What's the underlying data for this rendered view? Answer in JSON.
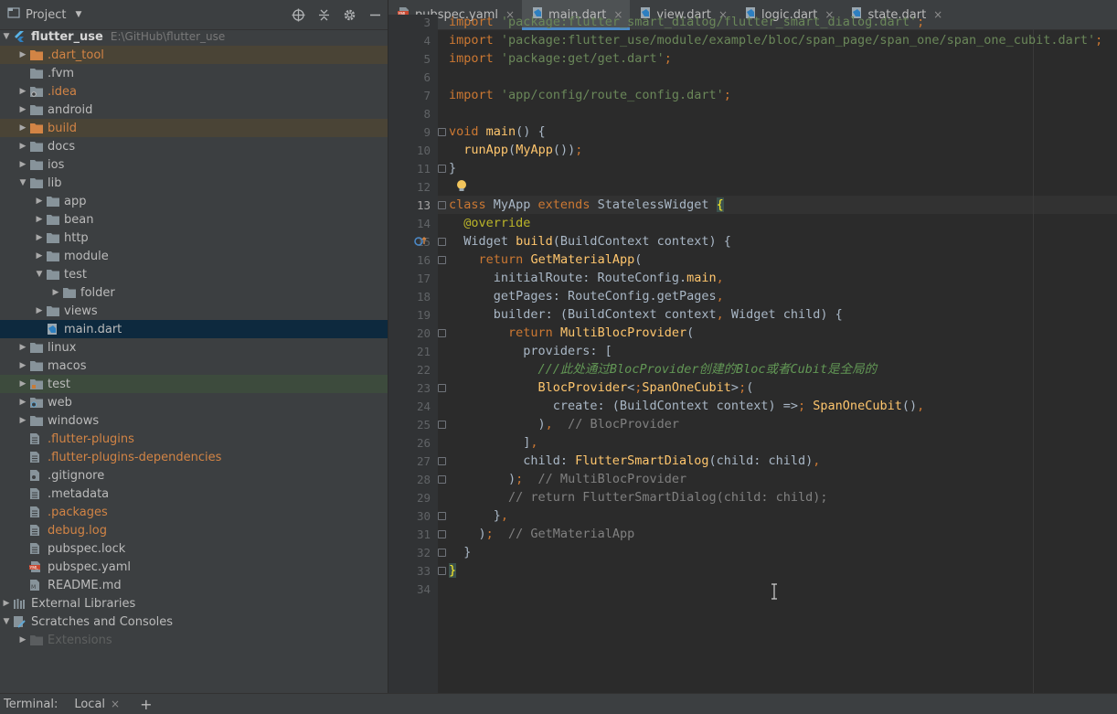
{
  "project": {
    "title": "Project",
    "root_name": "flutter_use",
    "root_path": "E:\\GitHub\\flutter_use",
    "items": [
      {
        "label": ".dart_tool",
        "style": "orange"
      },
      {
        "label": ".fvm",
        "style": ""
      },
      {
        "label": ".idea",
        "style": "orange"
      },
      {
        "label": "android",
        "style": ""
      },
      {
        "label": "build",
        "style": "orange"
      },
      {
        "label": "docs",
        "style": ""
      },
      {
        "label": "ios",
        "style": ""
      },
      {
        "label": "lib",
        "style": ""
      },
      {
        "label": "app",
        "style": ""
      },
      {
        "label": "bean",
        "style": ""
      },
      {
        "label": "http",
        "style": ""
      },
      {
        "label": "module",
        "style": ""
      },
      {
        "label": "test",
        "style": ""
      },
      {
        "label": "folder",
        "style": ""
      },
      {
        "label": "views",
        "style": ""
      },
      {
        "label": "main.dart",
        "style": ""
      },
      {
        "label": "linux",
        "style": ""
      },
      {
        "label": "macos",
        "style": ""
      },
      {
        "label": "test",
        "style": ""
      },
      {
        "label": "web",
        "style": ""
      },
      {
        "label": "windows",
        "style": ""
      },
      {
        "label": ".flutter-plugins",
        "style": "orange"
      },
      {
        "label": ".flutter-plugins-dependencies",
        "style": "orange"
      },
      {
        "label": ".gitignore",
        "style": ""
      },
      {
        "label": ".metadata",
        "style": ""
      },
      {
        "label": ".packages",
        "style": "orange"
      },
      {
        "label": "debug.log",
        "style": "orange"
      },
      {
        "label": "pubspec.lock",
        "style": ""
      },
      {
        "label": "pubspec.yaml",
        "style": ""
      },
      {
        "label": "README.md",
        "style": ""
      },
      {
        "label": "External Libraries",
        "style": ""
      },
      {
        "label": "Scratches and Consoles",
        "style": ""
      },
      {
        "label": "Extensions",
        "style": "dim"
      }
    ]
  },
  "tabs": [
    {
      "label": "pubspec.yaml",
      "active": false
    },
    {
      "label": "main.dart",
      "active": true
    },
    {
      "label": "view.dart",
      "active": false
    },
    {
      "label": "logic.dart",
      "active": false
    },
    {
      "label": "state.dart",
      "active": false
    }
  ],
  "code": {
    "line_numbers": [
      "3",
      "4",
      "5",
      "6",
      "7",
      "8",
      "9",
      "10",
      "11",
      "12",
      "13",
      "14",
      "15",
      "16",
      "17",
      "18",
      "19",
      "20",
      "21",
      "22",
      "23",
      "24",
      "25",
      "26",
      "27",
      "28",
      "29",
      "30",
      "31",
      "32",
      "33",
      "34"
    ],
    "current_line": "13",
    "lines": [
      "import 'package:flutter_smart_dialog/flutter_smart_dialog.dart';",
      "import 'package:flutter_use/module/example/bloc/span_page/span_one/span_one_cubit.dart';",
      "import 'package:get/get.dart';",
      "",
      "import 'app/config/route_config.dart';",
      "",
      "void main() {",
      "  runApp(MyApp());",
      "}",
      "",
      "class MyApp extends StatelessWidget {",
      "  @override",
      "  Widget build(BuildContext context) {",
      "    return GetMaterialApp(",
      "      initialRoute: RouteConfig.main,",
      "      getPages: RouteConfig.getPages,",
      "      builder: (BuildContext context, Widget child) {",
      "        return MultiBlocProvider(",
      "          providers: [",
      "            ///此处通过BlocProvider创建的Bloc或者Cubit是全局的",
      "            BlocProvider<SpanOneCubit>(",
      "              create: (BuildContext context) => SpanOneCubit(),",
      "            ),  // BlocProvider",
      "          ],",
      "          child: FlutterSmartDialog(child: child),",
      "        );  // MultiBlocProvider",
      "        // return FlutterSmartDialog(child: child);",
      "      },",
      "    );  // GetMaterialApp",
      "  }",
      "}",
      ""
    ]
  },
  "bottom": {
    "label": "Terminal:",
    "tab": "Local",
    "close": "×",
    "add": "+"
  }
}
